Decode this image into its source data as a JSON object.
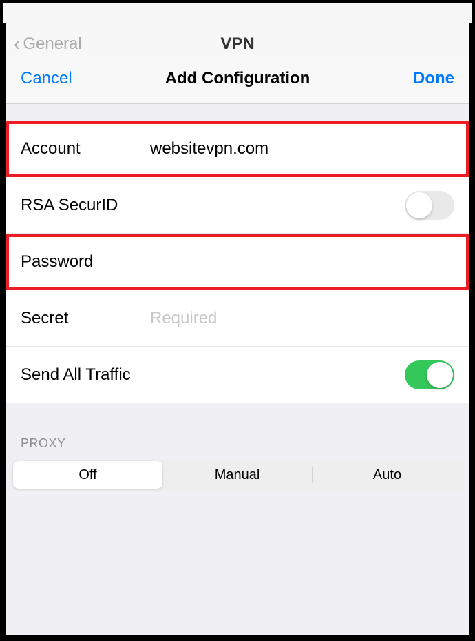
{
  "background": {
    "back_button": "General",
    "page_title": "VPN"
  },
  "modal": {
    "cancel_label": "Cancel",
    "title": "Add Configuration",
    "done_label": "Done"
  },
  "form": {
    "account": {
      "label": "Account",
      "value": "websitevpn.com"
    },
    "rsa_securid": {
      "label": "RSA SecurID",
      "enabled": false
    },
    "password": {
      "label": "Password",
      "value": ""
    },
    "secret": {
      "label": "Secret",
      "placeholder": "Required",
      "value": ""
    },
    "send_all_traffic": {
      "label": "Send All Traffic",
      "enabled": true
    }
  },
  "proxy": {
    "header": "PROXY",
    "segments": [
      "Off",
      "Manual",
      "Auto"
    ],
    "selected": "Off"
  }
}
